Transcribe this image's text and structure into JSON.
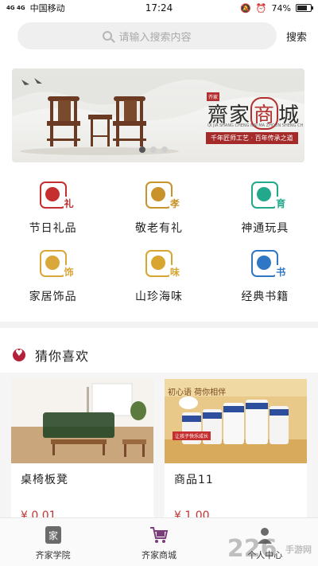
{
  "status": {
    "network": "4G 4G",
    "carrier": "中国移动",
    "time": "17:24",
    "battery": "74%",
    "battery_level": 0.74
  },
  "search": {
    "placeholder": "请输入搜索内容",
    "button": "搜索"
  },
  "banner": {
    "brand_prefix": "齋家",
    "brand_seal": "商",
    "brand_suffix": "城",
    "tag": "齐家",
    "subtitle": "QI JIA SHANG CHENG NAI MA ZHOUN SHENG CHU WU QI JIA",
    "slogan": "千年匠师工艺 · 百年传承之道",
    "active_slide": 1
  },
  "categories": [
    {
      "label": "节日礼品",
      "char": "礼",
      "color": "#c62f2f",
      "icon": "gift-icon"
    },
    {
      "label": "敬老有礼",
      "char": "孝",
      "color": "#c8932b",
      "icon": "elder-icon"
    },
    {
      "label": "神通玩具",
      "char": "育",
      "color": "#22a88a",
      "icon": "ball-icon"
    },
    {
      "label": "家居饰品",
      "char": "饰",
      "color": "#d9a73a",
      "icon": "hat-icon"
    },
    {
      "label": "山珍海味",
      "char": "味",
      "color": "#d8a52f",
      "icon": "grain-icon"
    },
    {
      "label": "经典书籍",
      "char": "书",
      "color": "#2f77c4",
      "icon": "book-icon"
    }
  ],
  "guess": {
    "title": "猜你喜欢",
    "products": [
      {
        "name": "桌椅板凳",
        "price": "¥ 0.01"
      },
      {
        "name": "商品11",
        "price": "¥ 1.00"
      }
    ],
    "product2_banner": "初心语 荷你相伴",
    "product2_tag": "让孩子快乐成长"
  },
  "tabbar": {
    "tabs": [
      {
        "label": "齐家学院",
        "icon": "school-icon"
      },
      {
        "label": "齐家商城",
        "icon": "cart-icon"
      },
      {
        "label": "个人中心",
        "icon": "user-icon"
      }
    ]
  },
  "watermark": {
    "number": "226",
    "text": "手游网"
  }
}
